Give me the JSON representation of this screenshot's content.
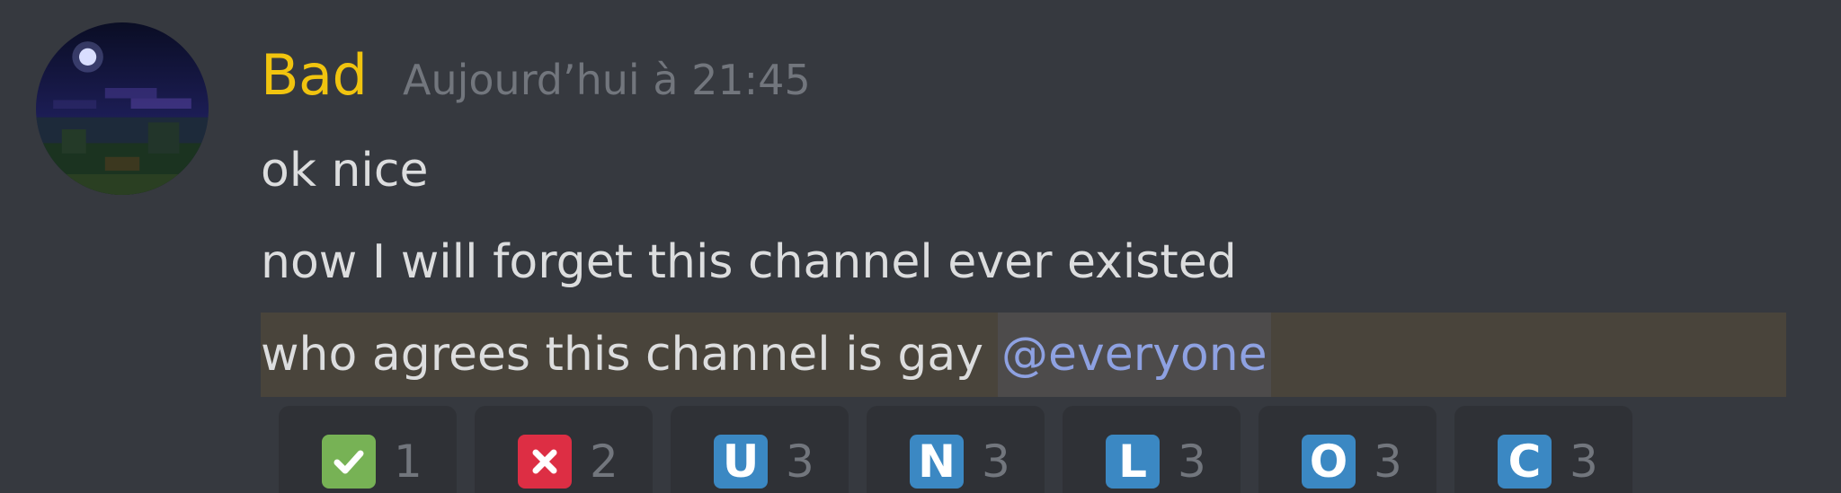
{
  "message": {
    "author": "Bad",
    "author_color": "#f1c40f",
    "timestamp": "Aujourd’hui à 21:45",
    "lines": [
      "ok nice",
      "now I will forget this channel ever existed"
    ],
    "mention_line": {
      "text": "who agrees this channel is gay",
      "mention": "@everyone"
    }
  },
  "reactions": [
    {
      "emoji": "check-mark-icon",
      "glyph": "",
      "count": "1",
      "color": "#77b255"
    },
    {
      "emoji": "cross-mark-icon",
      "glyph": "",
      "count": "2",
      "color": "#dd2e44"
    },
    {
      "emoji": "regional-indicator-u-icon",
      "glyph": "U",
      "count": "3",
      "color": "#3b88c3"
    },
    {
      "emoji": "regional-indicator-n-icon",
      "glyph": "N",
      "count": "3",
      "color": "#3b88c3"
    },
    {
      "emoji": "regional-indicator-l-icon",
      "glyph": "L",
      "count": "3",
      "color": "#3b88c3"
    },
    {
      "emoji": "regional-indicator-o-icon",
      "glyph": "O",
      "count": "3",
      "color": "#3b88c3"
    },
    {
      "emoji": "regional-indicator-c-icon",
      "glyph": "C",
      "count": "3",
      "color": "#3b88c3"
    }
  ]
}
